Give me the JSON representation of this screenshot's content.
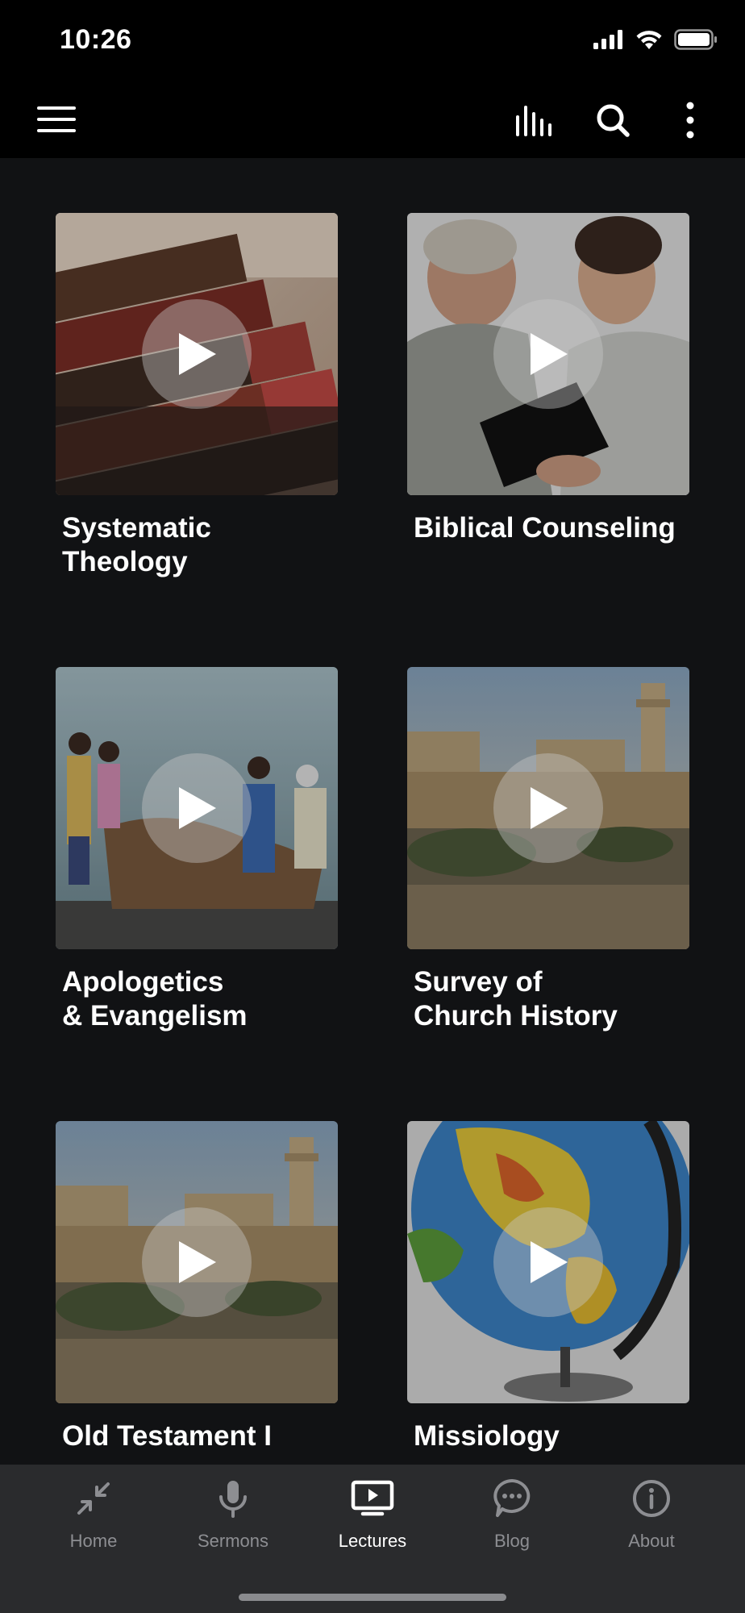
{
  "status_bar": {
    "time": "10:26",
    "icons": [
      "cellular-signal-icon",
      "wifi-icon",
      "battery-icon"
    ]
  },
  "app_bar": {
    "menu_icon": "hamburger-menu-icon",
    "actions": [
      "equalizer-bars-icon",
      "search-icon",
      "more-vertical-icon"
    ]
  },
  "lectures": [
    {
      "title": "Systematic\nTheology",
      "image": "old-books-photo"
    },
    {
      "title": "Biblical Counseling",
      "image": "men-counseling-photo"
    },
    {
      "title": "Apologetics\n& Evangelism",
      "image": "fishermen-net-photo"
    },
    {
      "title": "Survey of\nChurch History",
      "image": "jerusalem-citadel-photo"
    },
    {
      "title": "Old Testament I",
      "image": "jerusalem-citadel-photo"
    },
    {
      "title": "Missiology",
      "image": "globe-photo"
    }
  ],
  "tab_bar": {
    "tabs": [
      {
        "label": "Home",
        "icon": "collapse-arrows-icon",
        "active": false
      },
      {
        "label": "Sermons",
        "icon": "microphone-icon",
        "active": false
      },
      {
        "label": "Lectures",
        "icon": "play-screen-icon",
        "active": true
      },
      {
        "label": "Blog",
        "icon": "chat-bubble-icon",
        "active": false
      },
      {
        "label": "About",
        "icon": "info-icon",
        "active": false
      }
    ]
  },
  "colors": {
    "background": "#111214",
    "top_bar": "#000000",
    "tab_bar": "#2a2b2d",
    "active_tab": "#ffffff",
    "inactive_tab": "#8d8e92"
  }
}
